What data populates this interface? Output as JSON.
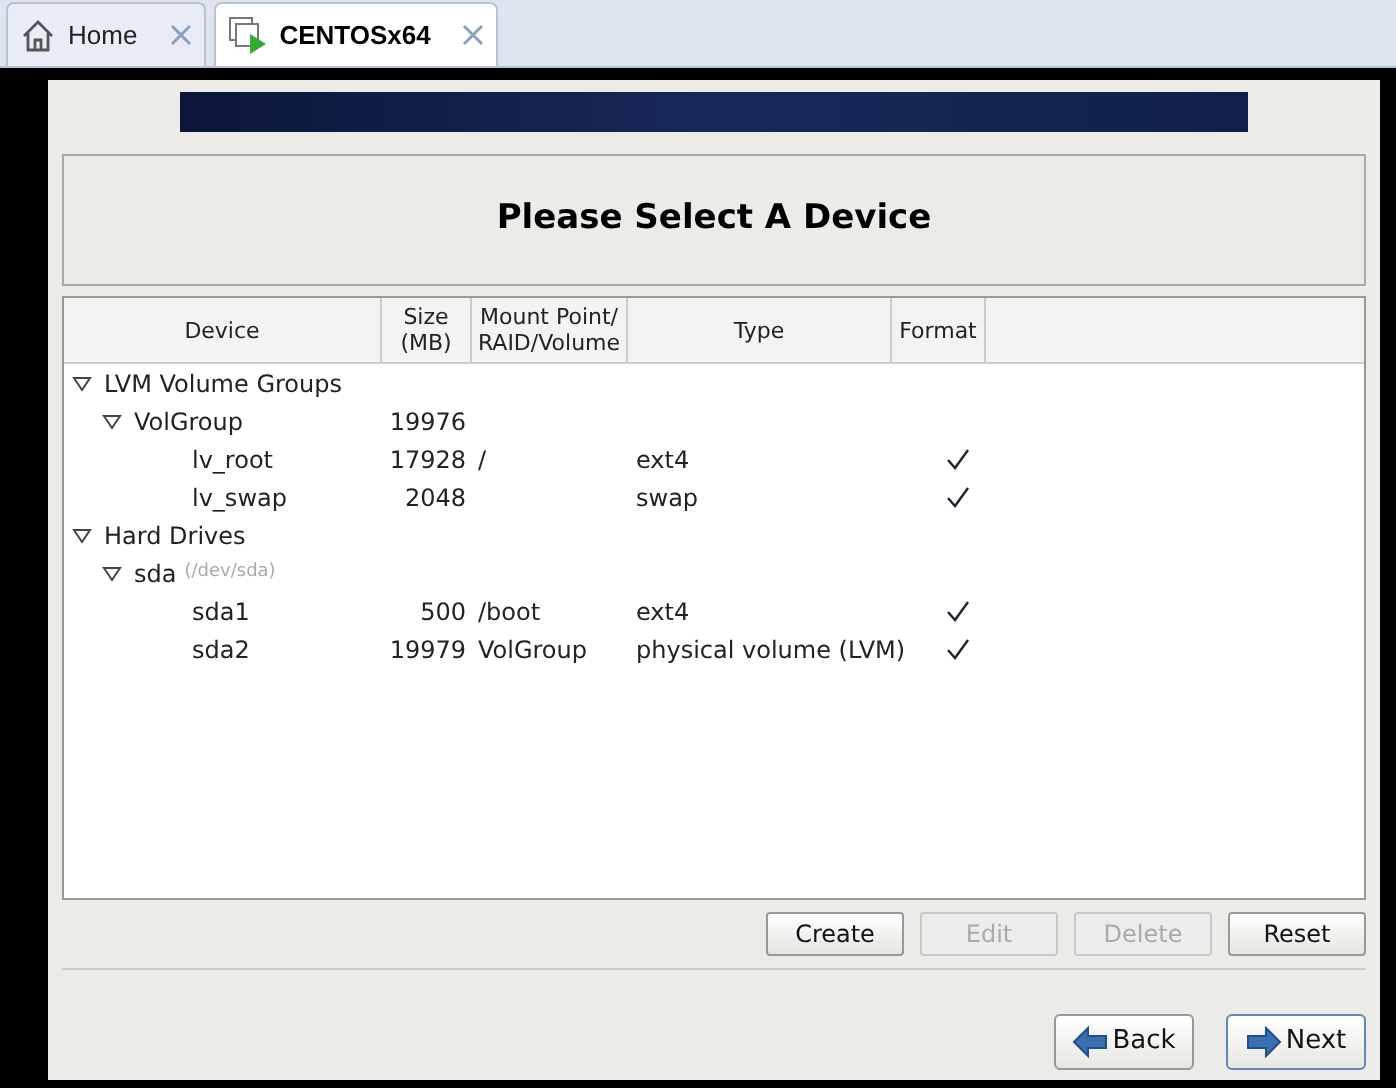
{
  "tabs": [
    {
      "label": "Home",
      "kind": "home",
      "selected": false
    },
    {
      "label": "CENTOSx64",
      "kind": "vm",
      "selected": true
    }
  ],
  "title": "Please Select A Device",
  "table": {
    "columns": [
      "Device",
      "Size\n(MB)",
      "Mount Point/\nRAID/Volume",
      "Type",
      "Format"
    ],
    "rows": [
      {
        "device": "LVM Volume Groups",
        "expanded": true,
        "children": [
          {
            "device": "VolGroup",
            "size": "19976",
            "expanded": true,
            "children": [
              {
                "device": "lv_root",
                "size": "17928",
                "mount": "/",
                "type": "ext4",
                "format": true
              },
              {
                "device": "lv_swap",
                "size": "2048",
                "type": "swap",
                "format": true
              }
            ]
          }
        ]
      },
      {
        "device": "Hard Drives",
        "expanded": true,
        "children": [
          {
            "device": "sda",
            "hint": "(/dev/sda)",
            "expanded": true,
            "children": [
              {
                "device": "sda1",
                "size": "500",
                "mount": "/boot",
                "type": "ext4",
                "format": true
              },
              {
                "device": "sda2",
                "size": "19979",
                "mount": "VolGroup",
                "type": "physical volume (LVM)",
                "format": true
              }
            ]
          }
        ]
      }
    ]
  },
  "actions": [
    {
      "label": "Create",
      "disabled": false
    },
    {
      "label": "Edit",
      "disabled": true
    },
    {
      "label": "Delete",
      "disabled": true
    },
    {
      "label": "Reset",
      "disabled": false
    }
  ],
  "nav": [
    {
      "label": "Back",
      "kind": "back",
      "selected": false
    },
    {
      "label": "Next",
      "kind": "next",
      "selected": true
    }
  ]
}
